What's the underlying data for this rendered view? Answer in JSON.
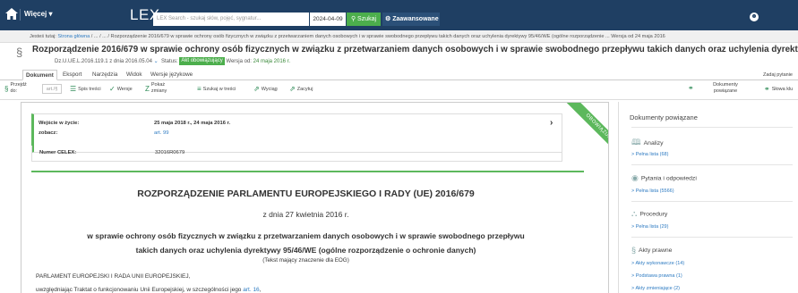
{
  "topbar": {
    "menu_label": "Więcej",
    "brand": "LEX",
    "search_placeholder": "LEX Search - szukaj słów, pojęć, sygnatur...",
    "date": "2024-04-09",
    "search_button": "Szukaj",
    "advanced_button": "Zaawansowane"
  },
  "breadcrumb": {
    "prefix": "Jesteś tutaj:",
    "home": "Strona główna",
    "trail": "/ ... / ... /",
    "current": "Rozporządzenie 2016/679 w sprawie ochrony osób fizycznych w związku z przetwarzaniem danych osobowych i w sprawie swobodnego przepływu takich danych oraz uchylenia dyrektywy 95/46/WE (ogólne rozporządzenie ... Wersja od 24 maja 2016"
  },
  "document": {
    "title": "Rozporządzenie 2016/679 w sprawie ochrony osób fizycznych w związku z przetwarzaniem danych osobowych i w sprawie swobodnego przepływu takich danych oraz uchylenia dyrektywy...",
    "source": "Dz.U.UE.L.2016.119.1 z dnia 2016.05.04",
    "status_label": "Status:",
    "status": "Akt obowiązujący",
    "version_label": "Wersja od:",
    "version": "24 maja 2016 r."
  },
  "tabs": [
    "Dokument",
    "Eksport",
    "Narzędzia",
    "Widok",
    "Wersje językowe"
  ],
  "tabs_right": "Zadaj pytanie",
  "toolbar": {
    "goto": "Przejdź do:",
    "art_placeholder": "art./§",
    "toc": "Spis treści",
    "versions": "Wersje",
    "show_changes": "Pokaż zmiany",
    "search_in": "Szukaj w treści",
    "excerpt": "Wyciąg",
    "bookmark": "Zacytuj",
    "related": "Dokumenty powiązane",
    "keywords": "Słowa klu"
  },
  "info": {
    "effective_label": "Wejście w życie:",
    "effective_value": "25 maja 2018 r., 24 maja 2016 r.",
    "applies_label": "zobacz:",
    "applies_link": "art. 99",
    "celex_label": "Numer CELEX:",
    "celex_value": "32016R0679",
    "ribbon": "OBOWIĄZUJĄCY"
  },
  "body": {
    "heading": "ROZPORZĄDZENIE PARLAMENTU EUROPEJSKIEGO I RADY (UE) 2016/679",
    "date_line": "z dnia 27 kwietnia 2016 r.",
    "subject_line1": "w sprawie ochrony osób fizycznych w związku z przetwarzaniem danych osobowych i w sprawie swobodnego przepływu",
    "subject_line2": "takich danych oraz uchylenia dyrektywy 95/46/WE (ogólne rozporządzenie o ochronie danych)",
    "eea_note": "(Tekst mający znaczenie dla EOG)",
    "para1": "PARLAMENT EUROPEJSKI I RADA UNII EUROPEJSKIEJ,",
    "para2_text": "uwzględniając Traktat o funkcjonowaniu Unii Europejskiej, w szczególności jego",
    "para2_link": "art. 16"
  },
  "sidebar": {
    "title": "Dokumenty powiązane",
    "sections": [
      {
        "label": "Analizy",
        "link": "Pełna lista (68)"
      },
      {
        "label": "Pytania i odpowiedzi",
        "link": "Pełna lista (5566)"
      },
      {
        "label": "Procedury",
        "link": "Pełna lista (29)"
      },
      {
        "label": "Akty prawne",
        "links": [
          "Akty wykonawcze (14)",
          "Podstawa prawna (1)",
          "Akty zmieniające (2)"
        ]
      }
    ]
  },
  "colors": {
    "topbar": "#1f3f63",
    "accent_green": "#5cb85c",
    "link": "#2e7bc2"
  }
}
